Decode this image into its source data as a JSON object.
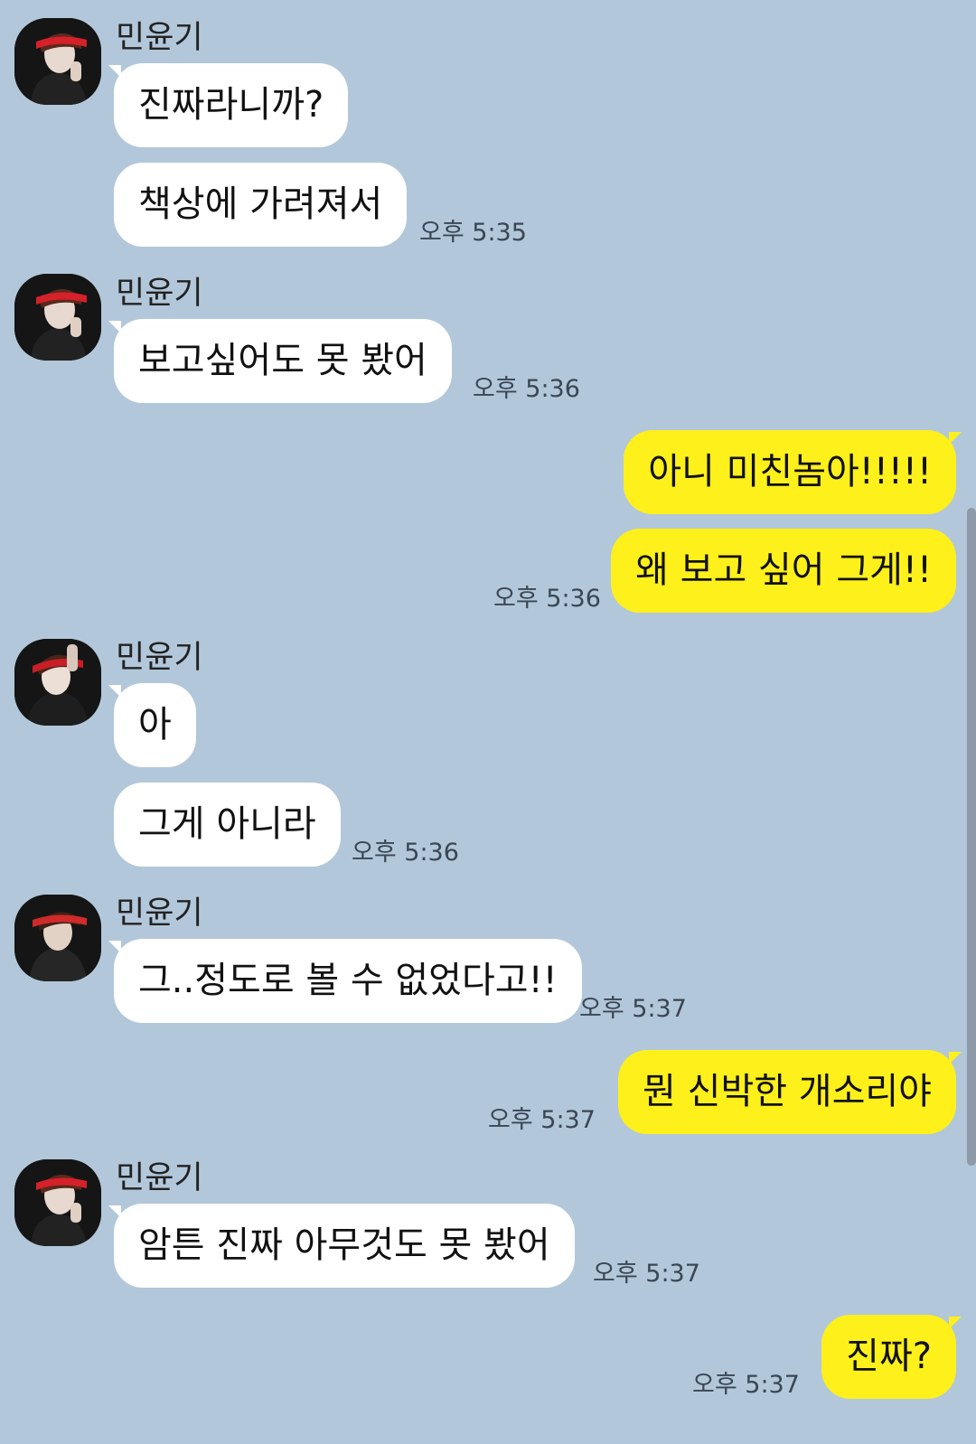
{
  "sender_name": "민윤기",
  "messages": [
    {
      "text": "진짜라니까?"
    },
    {
      "text": "책상에 가려져서",
      "time": "오후 5:35"
    },
    {
      "text": "보고싶어도 못 봤어",
      "time": "오후 5:36"
    },
    {
      "text": "아니 미친놈아!!!!!"
    },
    {
      "text": "왜 보고 싶어 그게!!",
      "time": "오후 5:36"
    },
    {
      "text": "아"
    },
    {
      "text": "그게 아니라",
      "time": "오후 5:36"
    },
    {
      "text": "그..정도로 볼 수 없었다고!!",
      "time": "오후 5:37"
    },
    {
      "text": "뭔 신박한 개소리야",
      "time": "오후 5:37"
    },
    {
      "text": "암튼 진짜 아무것도 못 봤어",
      "time": "오후 5:37"
    },
    {
      "text": "진짜?",
      "time": "오후 5:37"
    }
  ],
  "colors": {
    "background": "#b2c7da",
    "incoming_bubble": "#ffffff",
    "outgoing_bubble": "#fef01b"
  },
  "icons": {
    "avatar": "profile-photo",
    "scrollbar": "scrollbar-thumb"
  }
}
